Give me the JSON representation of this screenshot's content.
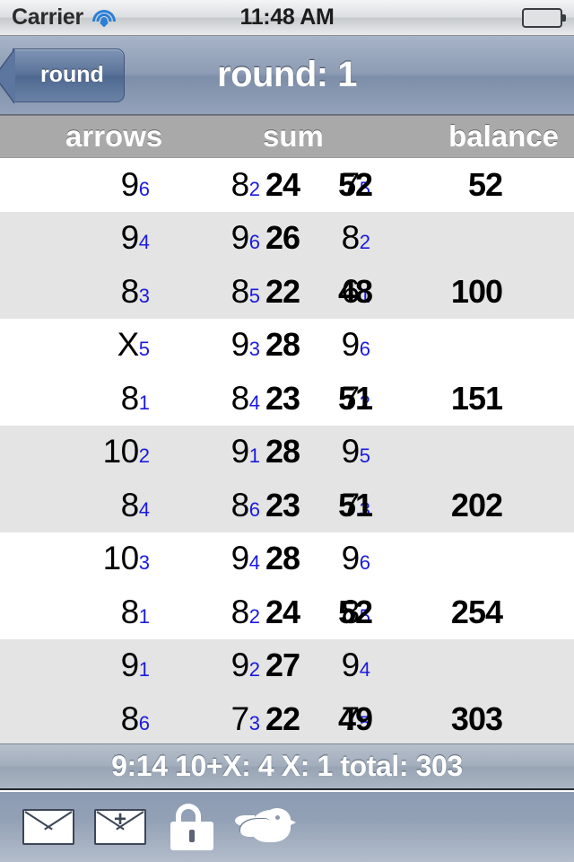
{
  "statusbar": {
    "carrier": "Carrier",
    "time": "11:48 AM",
    "wifi_icon": "wifi-icon",
    "battery_icon": "battery-full-icon"
  },
  "navbar": {
    "back_label": "round",
    "title": "round: 1"
  },
  "table": {
    "headers": {
      "arrows": "arrows",
      "sum": "sum",
      "balance": "balance"
    },
    "rows": [
      {
        "arrows": [
          {
            "value": "9",
            "sub": "6"
          },
          {
            "value": "8",
            "sub": "2"
          },
          {
            "value": "7",
            "sub": "5"
          }
        ],
        "sum": "24",
        "pair": "52",
        "balance": "52",
        "shaded": false
      },
      {
        "arrows": [
          {
            "value": "9",
            "sub": "4"
          },
          {
            "value": "9",
            "sub": "6"
          },
          {
            "value": "8",
            "sub": "2"
          }
        ],
        "sum": "26",
        "pair": "",
        "balance": "",
        "shaded": true
      },
      {
        "arrows": [
          {
            "value": "8",
            "sub": "3"
          },
          {
            "value": "8",
            "sub": "5"
          },
          {
            "value": "6",
            "sub": "1"
          }
        ],
        "sum": "22",
        "pair": "48",
        "balance": "100",
        "shaded": true
      },
      {
        "arrows": [
          {
            "value": "X",
            "sub": "5"
          },
          {
            "value": "9",
            "sub": "3"
          },
          {
            "value": "9",
            "sub": "6"
          }
        ],
        "sum": "28",
        "pair": "",
        "balance": "",
        "shaded": false
      },
      {
        "arrows": [
          {
            "value": "8",
            "sub": "1"
          },
          {
            "value": "8",
            "sub": "4"
          },
          {
            "value": "7",
            "sub": "2"
          }
        ],
        "sum": "23",
        "pair": "51",
        "balance": "151",
        "shaded": false
      },
      {
        "arrows": [
          {
            "value": "10",
            "sub": "2"
          },
          {
            "value": "9",
            "sub": "1"
          },
          {
            "value": "9",
            "sub": "5"
          }
        ],
        "sum": "28",
        "pair": "",
        "balance": "",
        "shaded": true
      },
      {
        "arrows": [
          {
            "value": "8",
            "sub": "4"
          },
          {
            "value": "8",
            "sub": "6"
          },
          {
            "value": "7",
            "sub": "3"
          }
        ],
        "sum": "23",
        "pair": "51",
        "balance": "202",
        "shaded": true
      },
      {
        "arrows": [
          {
            "value": "10",
            "sub": "3"
          },
          {
            "value": "9",
            "sub": "4"
          },
          {
            "value": "9",
            "sub": "6"
          }
        ],
        "sum": "28",
        "pair": "",
        "balance": "",
        "shaded": false
      },
      {
        "arrows": [
          {
            "value": "8",
            "sub": "1"
          },
          {
            "value": "8",
            "sub": "2"
          },
          {
            "value": "8",
            "sub": "5"
          }
        ],
        "sum": "24",
        "pair": "52",
        "balance": "254",
        "shaded": false
      },
      {
        "arrows": [
          {
            "value": "9",
            "sub": "1"
          },
          {
            "value": "9",
            "sub": "2"
          },
          {
            "value": "9",
            "sub": "4"
          }
        ],
        "sum": "27",
        "pair": "",
        "balance": "",
        "shaded": true
      },
      {
        "arrows": [
          {
            "value": "8",
            "sub": "6"
          },
          {
            "value": "7",
            "sub": "3"
          },
          {
            "value": "7",
            "sub": "5"
          }
        ],
        "sum": "22",
        "pair": "49",
        "balance": "303",
        "shaded": true
      }
    ]
  },
  "status_strip": {
    "text": "9:14 10+X: 4 X: 1 total: 303"
  },
  "toolbar": {
    "items": [
      {
        "name": "mail-icon",
        "label": ""
      },
      {
        "name": "mail-add-icon",
        "label": ""
      },
      {
        "name": "lock-icon",
        "label": ""
      },
      {
        "name": "bird-icon",
        "label": ""
      }
    ]
  },
  "colors": {
    "subscript_blue": "#1a1ae0",
    "header_gray": "#a9a9a9",
    "row_shaded": "#e4e4e4",
    "navbar_blue": "#8d9cb4",
    "battery_green": "#5fc417"
  }
}
